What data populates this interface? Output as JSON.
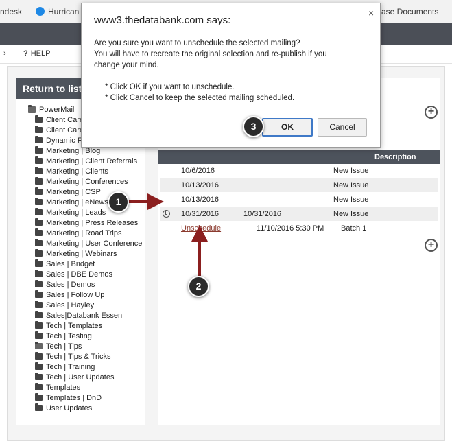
{
  "bookmarks": [
    {
      "label": "ndesk",
      "icon": ""
    },
    {
      "label": "Hurrican",
      "icon": "hurricane-icon"
    },
    {
      "label": "ase Documents",
      "icon": ""
    }
  ],
  "menu": {
    "chevron": "›",
    "help_icon": "?",
    "help_label": "HELP"
  },
  "sidebar": {
    "header": "Return to list",
    "folders": [
      {
        "label": "PowerMail",
        "open": true,
        "level": 0
      },
      {
        "label": "Client Care",
        "open": false,
        "level": 1
      },
      {
        "label": "Client Care",
        "open": false,
        "level": 1
      },
      {
        "label": "Dynamic F",
        "open": false,
        "level": 1
      },
      {
        "label": "Marketing | Blog",
        "open": false,
        "level": 1
      },
      {
        "label": "Marketing | Client Referrals",
        "open": false,
        "level": 1
      },
      {
        "label": "Marketing | Clients",
        "open": false,
        "level": 1
      },
      {
        "label": "Marketing | Conferences",
        "open": false,
        "level": 1
      },
      {
        "label": "Marketing | CSP",
        "open": false,
        "level": 1
      },
      {
        "label": "Marketing | eNews",
        "open": false,
        "level": 1
      },
      {
        "label": "Marketing | Leads",
        "open": false,
        "level": 1
      },
      {
        "label": "Marketing | Press Releases",
        "open": false,
        "level": 1
      },
      {
        "label": "Marketing | Road Trips",
        "open": false,
        "level": 1
      },
      {
        "label": "Marketing | User Conference",
        "open": false,
        "level": 1
      },
      {
        "label": "Marketing | Webinars",
        "open": false,
        "level": 1
      },
      {
        "label": "Sales | Bridget",
        "open": false,
        "level": 1
      },
      {
        "label": "Sales | DBE Demos",
        "open": false,
        "level": 1
      },
      {
        "label": "Sales | Demos",
        "open": false,
        "level": 1
      },
      {
        "label": "Sales | Follow Up",
        "open": false,
        "level": 1
      },
      {
        "label": "Sales | Hayley",
        "open": false,
        "level": 1
      },
      {
        "label": "Sales|Databank Essen",
        "open": false,
        "level": 1
      },
      {
        "label": "Tech | Templates",
        "open": false,
        "level": 1
      },
      {
        "label": "Tech | Testing",
        "open": false,
        "level": 1
      },
      {
        "label": "Tech | Tips",
        "open": true,
        "level": 1
      },
      {
        "label": "Tech | Tips & Tricks",
        "open": false,
        "level": 1
      },
      {
        "label": "Tech | Training",
        "open": false,
        "level": 1
      },
      {
        "label": "Tech | User Updates",
        "open": false,
        "level": 1
      },
      {
        "label": "Templates",
        "open": false,
        "level": 1
      },
      {
        "label": "Templates | DnD",
        "open": false,
        "level": 1
      },
      {
        "label": "User Updates",
        "open": false,
        "level": 1
      }
    ]
  },
  "table": {
    "desc_header": "Description",
    "rows": [
      {
        "date1": "10/6/2016",
        "date2": "",
        "desc": "New Issue",
        "scheduled": false
      },
      {
        "date1": "10/13/2016",
        "date2": "",
        "desc": "New Issue",
        "scheduled": false
      },
      {
        "date1": "10/13/2016",
        "date2": "",
        "desc": "New Issue",
        "scheduled": false
      },
      {
        "date1": "10/31/2016",
        "date2": "10/31/2016",
        "desc": "New Issue",
        "scheduled": true
      }
    ],
    "schedule_row": {
      "link": "Unschedule",
      "datetime": "11/10/2016 5:30 PM",
      "batch": "Batch 1"
    },
    "add_icon": "+"
  },
  "callouts": [
    "1",
    "2",
    "3"
  ],
  "dialog": {
    "title": "www3.thedatabank.com says:",
    "close": "×",
    "line1": "Are you sure you want to unschedule the selected mailing?",
    "line2": "You will have to recreate the original selection and re-publish if you",
    "line3": "change your mind.",
    "bullet1": "* Click OK if you want to unschedule.",
    "bullet2": "* Click Cancel to keep the selected mailing scheduled.",
    "ok": "OK",
    "cancel": "Cancel"
  }
}
